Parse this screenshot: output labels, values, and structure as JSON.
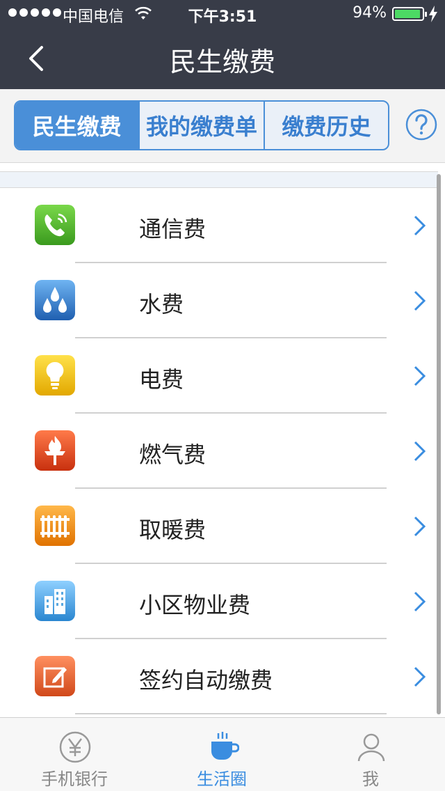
{
  "status": {
    "carrier": "中国电信",
    "time": "下午3:51",
    "battery_pct": "94%",
    "battery_level": 0.94
  },
  "nav": {
    "title": "民生缴费",
    "back_icon": "chevron-left-icon"
  },
  "segments": [
    {
      "label": "民生缴费",
      "active": true
    },
    {
      "label": "我的缴费单",
      "active": false
    },
    {
      "label": "缴费历史",
      "active": false
    }
  ],
  "help_icon": "question-circle-icon",
  "items": [
    {
      "label": "通信费",
      "icon": "phone-icon",
      "color": "#4caf2e"
    },
    {
      "label": "水费",
      "icon": "water-drops-icon",
      "color": "#2f7fd0"
    },
    {
      "label": "电费",
      "icon": "lightbulb-icon",
      "color": "#f2c400"
    },
    {
      "label": "燃气费",
      "icon": "gas-flame-icon",
      "color": "#e84a1c"
    },
    {
      "label": "取暖费",
      "icon": "radiator-icon",
      "color": "#f08c10"
    },
    {
      "label": "小区物业费",
      "icon": "building-icon",
      "color": "#3aa0e0"
    },
    {
      "label": "签约自动缴费",
      "icon": "edit-icon",
      "color": "#e8602a"
    }
  ],
  "tabs": [
    {
      "label": "手机银行",
      "icon": "yen-icon",
      "active": false
    },
    {
      "label": "生活圈",
      "icon": "coffee-cup-icon",
      "active": true
    },
    {
      "label": "我",
      "icon": "user-icon",
      "active": false
    }
  ],
  "colors": {
    "header_bg": "#383c48",
    "accent": "#4a8fd8",
    "tab_active": "#3a8de0"
  }
}
